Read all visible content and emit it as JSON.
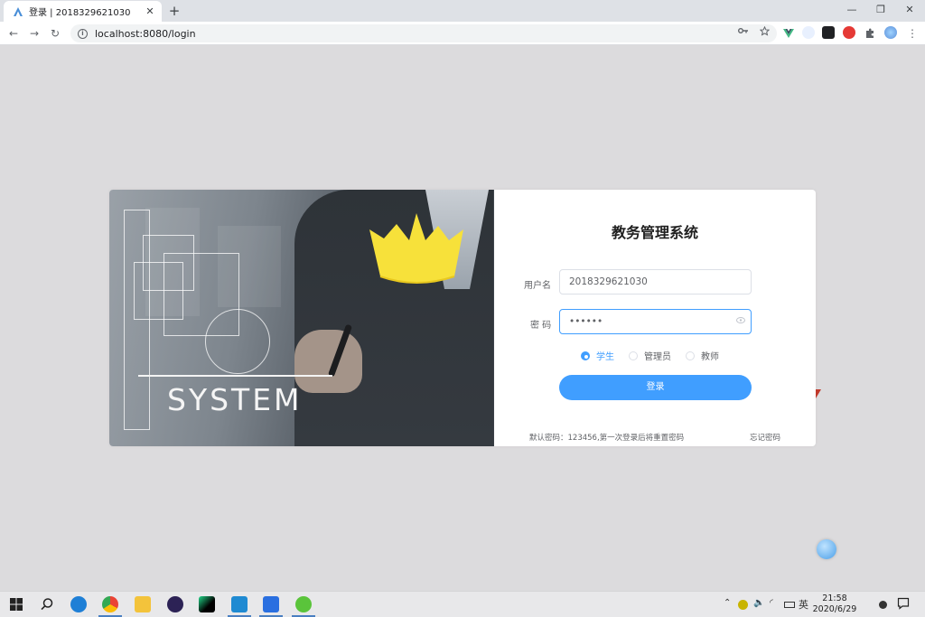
{
  "browser": {
    "tab_title": "登录 | 2018329621030",
    "tab_close": "✕",
    "new_tab": "+",
    "url": "localhost:8080/login",
    "window_controls": [
      "—",
      "❐",
      "✕"
    ],
    "nav": [
      "←",
      "→",
      "↻"
    ],
    "omnibox_icons": [
      "key-icon",
      "star-icon"
    ],
    "menu": "⋮"
  },
  "hero": {
    "system_text": "SYSTEM"
  },
  "login": {
    "title": "教务管理系统",
    "username_label": "用户名",
    "username_value": "2018329621030",
    "password_label": "密 码",
    "password_value": "••••••",
    "roles": [
      {
        "label": "学生",
        "selected": true
      },
      {
        "label": "管理员",
        "selected": false
      },
      {
        "label": "教师",
        "selected": false
      }
    ],
    "submit_label": "登录",
    "hint": "默认密码：123456,第一次登录后将重置密码",
    "forgot": "忘记密码"
  },
  "colors": {
    "primary": "#409eff",
    "crown": "#f7e13a",
    "page_bg": "#dcdbdd"
  },
  "taskbar": {
    "icons": [
      "windows-start-icon",
      "search-icon",
      "edge-icon",
      "chrome-icon",
      "file-explorer-icon",
      "eclipse-icon",
      "pycharm-icon",
      "vscode-icon",
      "shield-app-icon",
      "chat-app-icon"
    ],
    "ime": "英",
    "time": "21:58",
    "date": "2020/6/29"
  }
}
